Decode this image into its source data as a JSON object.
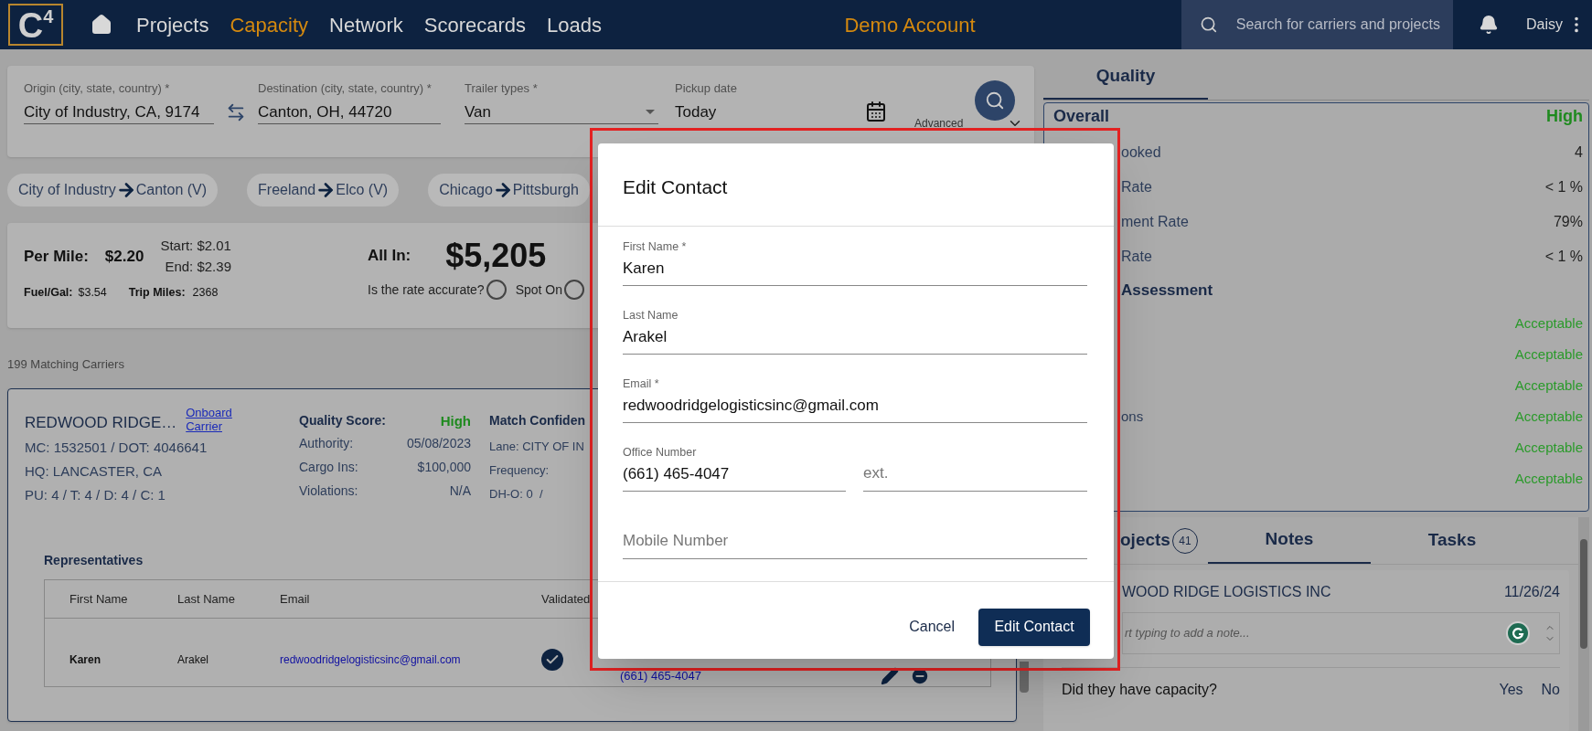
{
  "nav": {
    "logo": {
      "text": "C",
      "superscript": "4"
    },
    "items": [
      {
        "label": "Projects",
        "selected": false
      },
      {
        "label": "Capacity",
        "selected": true
      },
      {
        "label": "Network",
        "selected": false
      },
      {
        "label": "Scorecards",
        "selected": false
      },
      {
        "label": "Loads",
        "selected": false
      }
    ],
    "account": "Demo Account",
    "search": {
      "placeholder": "Search for carriers and projects"
    },
    "user": "Daisy"
  },
  "search_form": {
    "fields": [
      {
        "kind": "text",
        "label": "Origin (city, state, country) *",
        "value": "City of Industry, CA, 9174"
      },
      {
        "kind": "text",
        "label": "Destination (city, state, country) *",
        "value": "Canton, OH, 44720"
      },
      {
        "kind": "select",
        "label": "Trailer types *",
        "value": "Van"
      },
      {
        "kind": "date",
        "label": "Pickup date",
        "value": "Today"
      }
    ],
    "advanced": "Advanced"
  },
  "recent_lanes": [
    {
      "from": "City of Industry",
      "to": "Canton (V)"
    },
    {
      "from": "Freeland",
      "to": "Elco (V)"
    },
    {
      "from": "Chicago",
      "to": "Pittsburgh"
    }
  ],
  "rate": {
    "per_mile_label": "Per Mile:",
    "per_mile": "$2.20",
    "start": "Start: $2.01",
    "end": "End: $2.39",
    "fuel_label": "Fuel/Gal:",
    "fuel": "$3.54",
    "miles_label": "Trip Miles:",
    "miles": "2368",
    "all_in_label": "All In:",
    "all_in": "$5,205",
    "question": "Is the rate accurate?",
    "options": [
      {
        "label": "Spot On",
        "selected": false
      },
      {
        "selected": false
      }
    ]
  },
  "matching_count": "199 Matching Carriers",
  "carrier": {
    "name": "REDWOOD RIDGE…",
    "onboard": "Onboard Carrier",
    "ids": "MC: 1532501 / DOT: 4046641",
    "hq": "HQ: LANCASTER, CA",
    "counts": "PU: 4 / T: 4 / D: 4 / C: 1",
    "quality_label": "Quality Score:",
    "quality": "High",
    "details": [
      {
        "label": "Authority:",
        "value": "05/08/2023"
      },
      {
        "label": "Cargo Ins:",
        "value": "$100,000"
      },
      {
        "label": "Violations:",
        "value": "N/A"
      }
    ],
    "match_title": "Match Confiden",
    "match_lines": [
      "Lane: CITY OF IN",
      "Frequency:",
      "DH-O: 0  /"
    ],
    "representatives": {
      "title": "Representatives",
      "columns": [
        "First Name",
        "Last Name",
        "Email",
        "Validated"
      ],
      "rows": [
        {
          "first": "Karen",
          "last": "Arakel",
          "email": "redwoodridgelogisticsinc@gmail.com",
          "validated": true,
          "phone": "(661) 465-4047"
        }
      ]
    }
  },
  "quality_panel": {
    "tab": {
      "label": "Quality",
      "selected": true
    },
    "overall": {
      "label": "Overall",
      "value": "High"
    },
    "metrics": [
      {
        "label": "ooked",
        "value": "4"
      },
      {
        "label": "Rate",
        "value": "< 1 %"
      },
      {
        "label": "ment Rate",
        "value": "79%"
      },
      {
        "label": "Rate",
        "value": "< 1 %"
      }
    ],
    "risk_title": "Assessment",
    "risk": [
      {
        "value": "Acceptable"
      },
      {
        "value": "Acceptable"
      },
      {
        "value": "Acceptable"
      },
      {
        "label": "ons",
        "value": "Acceptable"
      },
      {
        "value": "Acceptable"
      },
      {
        "value": "Acceptable"
      }
    ]
  },
  "lower_tabs": [
    {
      "label": "ojects",
      "count": "41",
      "selected": false
    },
    {
      "label": "Notes",
      "selected": true
    },
    {
      "label": "Tasks",
      "selected": false
    }
  ],
  "note": {
    "company": "WOOD RIDGE LOGISTICS INC",
    "date": "11/26/24",
    "placeholder": "rt typing to add a note...",
    "question": "Did they have capacity?",
    "answers": [
      "Yes",
      "No"
    ]
  },
  "modal": {
    "title": "Edit Contact",
    "fields": [
      {
        "label": "First Name *",
        "value": "Karen"
      },
      {
        "label": "Last Name",
        "value": "Arakel"
      },
      {
        "label": "Email *",
        "value": "redwoodridgelogisticsinc@gmail.com"
      }
    ],
    "office": {
      "label": "Office Number",
      "value": "(661) 465-4047"
    },
    "ext": {
      "placeholder": "ext."
    },
    "mobile": {
      "placeholder": "Mobile Number"
    },
    "cancel": "Cancel",
    "submit": "Edit Contact"
  }
}
